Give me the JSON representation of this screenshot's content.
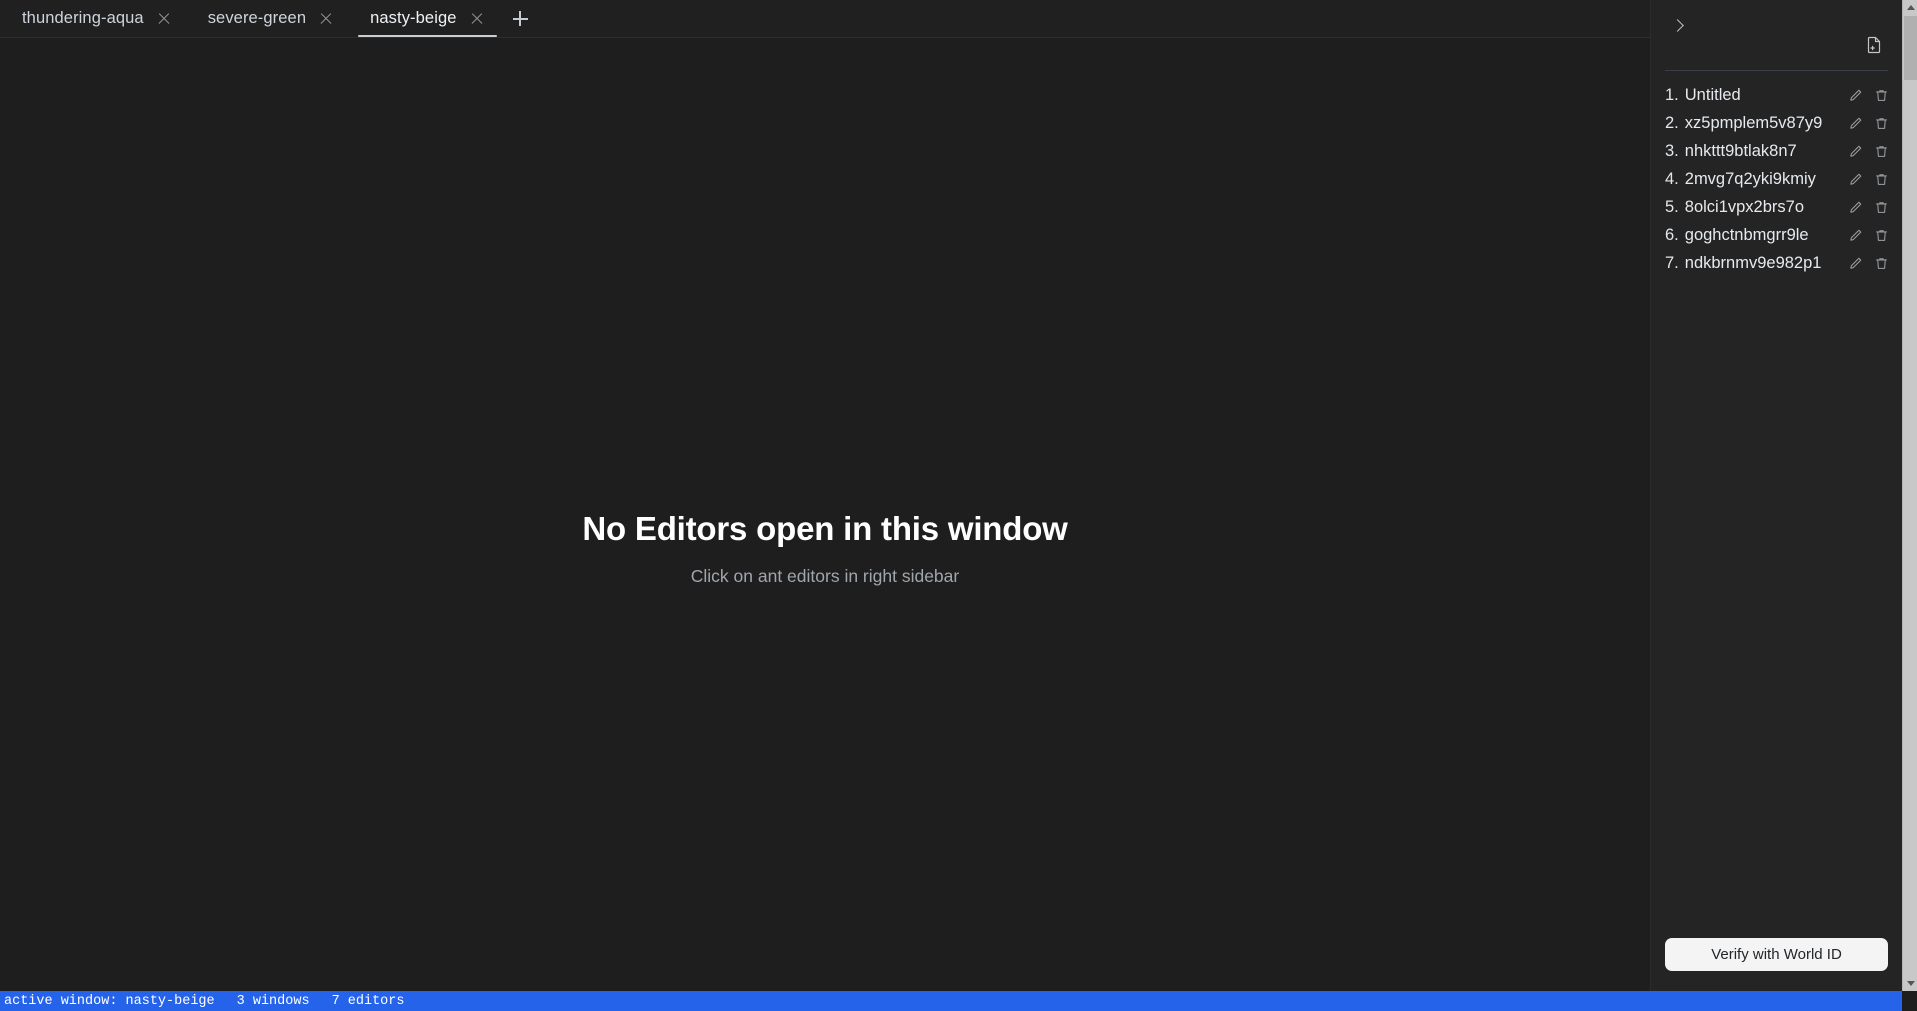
{
  "window": {
    "background": "#1e1e1e",
    "accent": "#2563eb"
  },
  "tabbar": {
    "tabs": [
      {
        "label": "thundering-aqua",
        "close_icon": "close-icon",
        "active": false
      },
      {
        "label": "severe-green",
        "close_icon": "close-icon",
        "active": false
      },
      {
        "label": "nasty-beige",
        "close_icon": "close-icon",
        "active": true
      }
    ],
    "add_tab_icon": "plus-icon",
    "add_tab_title": "New window"
  },
  "main": {
    "empty_title": "No Editors open in this window",
    "empty_subtitle": "Click on ant editors in right sidebar"
  },
  "sidebar": {
    "collapse_icon": "chevron-right-icon",
    "new_file_icon": "new-file-icon",
    "items": [
      {
        "index": "1.",
        "name": "Untitled",
        "edit_icon": "pencil-icon",
        "delete_icon": "trash-icon"
      },
      {
        "index": "2.",
        "name": "xz5pmplem5v87y9",
        "edit_icon": "pencil-icon",
        "delete_icon": "trash-icon"
      },
      {
        "index": "3.",
        "name": "nhkttt9btlak8n7",
        "edit_icon": "pencil-icon",
        "delete_icon": "trash-icon"
      },
      {
        "index": "4.",
        "name": "2mvg7q2yki9kmiy",
        "edit_icon": "pencil-icon",
        "delete_icon": "trash-icon"
      },
      {
        "index": "5.",
        "name": "8olci1vpx2brs7o",
        "edit_icon": "pencil-icon",
        "delete_icon": "trash-icon"
      },
      {
        "index": "6.",
        "name": "goghctnbmgrr9le",
        "edit_icon": "pencil-icon",
        "delete_icon": "trash-icon"
      },
      {
        "index": "7.",
        "name": "ndkbrnmv9e982p1",
        "edit_icon": "pencil-icon",
        "delete_icon": "trash-icon"
      }
    ],
    "verify_button": "Verify with World ID"
  },
  "scrollbar": {
    "up_icon": "scroll-up-arrow-icon",
    "down_icon": "scroll-down-arrow-icon"
  },
  "statusbar": {
    "active_window": "active window: nasty-beige",
    "windows_count": "3 windows",
    "editors_count": "7 editors"
  }
}
